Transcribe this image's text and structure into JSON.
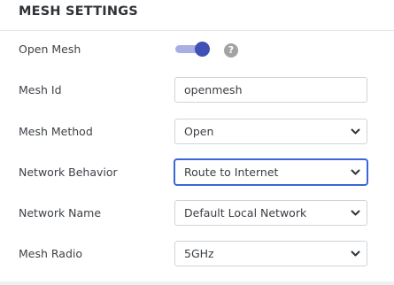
{
  "header": {
    "title": "MESH SETTINGS"
  },
  "open_mesh": {
    "label": "Open Mesh",
    "enabled": true,
    "help_icon": "question-circle-icon",
    "help_glyph": "?"
  },
  "mesh_id": {
    "label": "Mesh Id",
    "value": "openmesh"
  },
  "mesh_method": {
    "label": "Mesh Method",
    "value": "Open"
  },
  "network_behavior": {
    "label": "Network Behavior",
    "value": "Route to Internet"
  },
  "network_name": {
    "label": "Network Name",
    "value": "Default Local Network"
  },
  "mesh_radio": {
    "label": "Mesh Radio",
    "value": "5GHz"
  },
  "colors": {
    "accent": "#3f51b5",
    "toggle_track": "#a9aee4",
    "focus_border": "#3b66d6",
    "help_icon": "#a3a3a3"
  }
}
